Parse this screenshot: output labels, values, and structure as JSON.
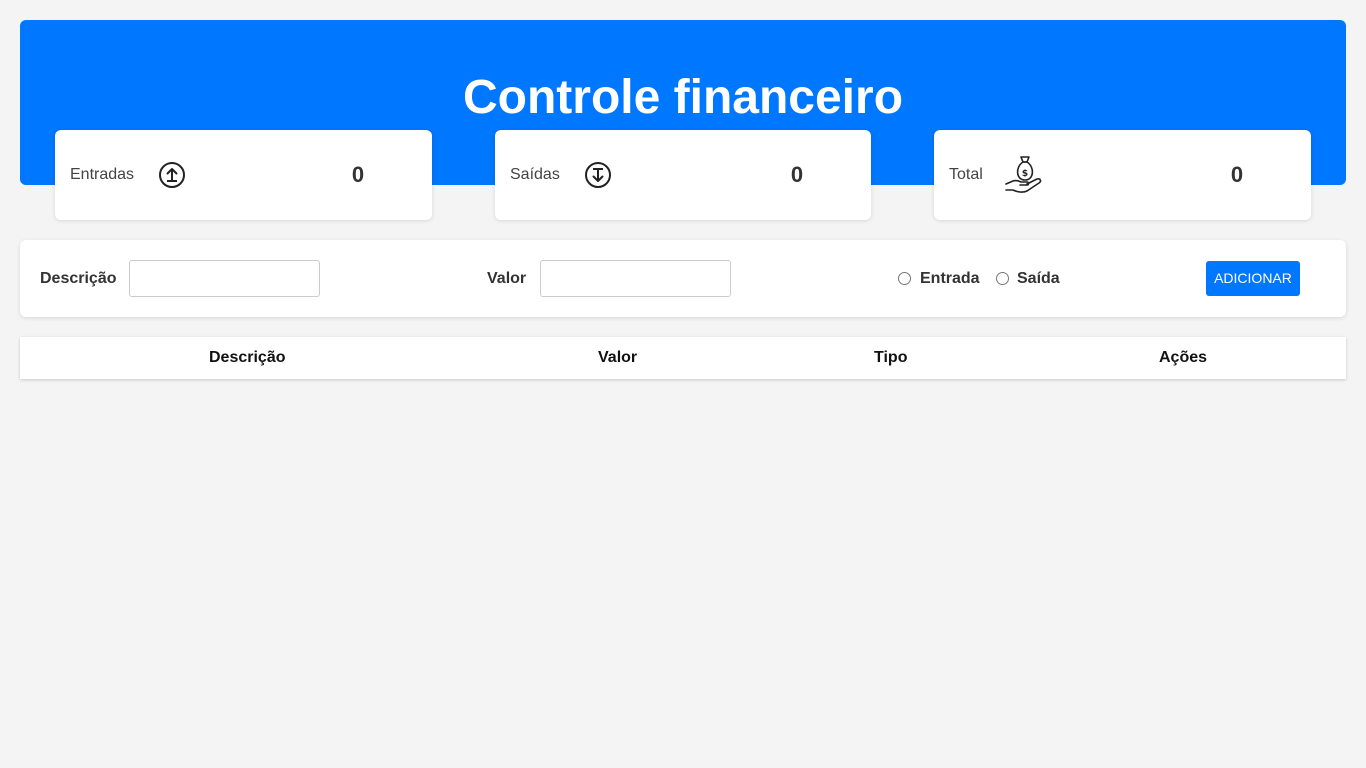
{
  "header": {
    "title": "Controle financeiro"
  },
  "cards": [
    {
      "label": "Entradas",
      "icon": "arrow-up-circle-icon",
      "value": "0"
    },
    {
      "label": "Saídas",
      "icon": "arrow-down-circle-icon",
      "value": "0"
    },
    {
      "label": "Total",
      "icon": "money-bag-hand-icon",
      "value": "0"
    }
  ],
  "form": {
    "description_label": "Descrição",
    "description_value": "",
    "value_label": "Valor",
    "value_value": "",
    "radio_entrada": "Entrada",
    "radio_saida": "Saída",
    "add_button": "ADICIONAR"
  },
  "table": {
    "headers": [
      "Descrição",
      "Valor",
      "Tipo",
      "Ações"
    ],
    "rows": []
  },
  "colors": {
    "accent": "#0077ff",
    "background": "#f4f4f4"
  }
}
